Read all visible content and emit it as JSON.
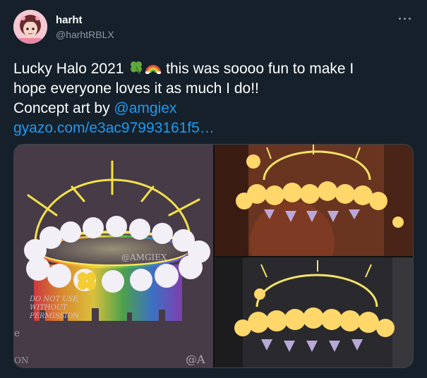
{
  "tweet": {
    "display_name": "harht",
    "handle": "@harhtRBLX",
    "text_line1_a": "Lucky Halo 2021",
    "text_line1_b": " this was soooo fun to make I",
    "text_line2": "hope everyone loves it as much I do!!",
    "text_line3_prefix": "Concept art by ",
    "mention": "@amgiex",
    "link": "gyazo.com/e3ac97993161f5…"
  },
  "media": {
    "watermark_center": "@AMGIEX",
    "watermark_line1": "DO NOT USE",
    "watermark_line2": "WITHOUT",
    "watermark_line3": "PERMISSION",
    "watermark_bottom_right": "@A",
    "watermark_bottom_left": "ON",
    "watermark_e": "e"
  },
  "icons": [
    "avatar",
    "more-icon",
    "four-leaf-clover-emoji",
    "rainbow-emoji"
  ],
  "colors": {
    "background": "#15202b",
    "link": "#1d9bf0",
    "secondary_text": "#8b98a5"
  }
}
